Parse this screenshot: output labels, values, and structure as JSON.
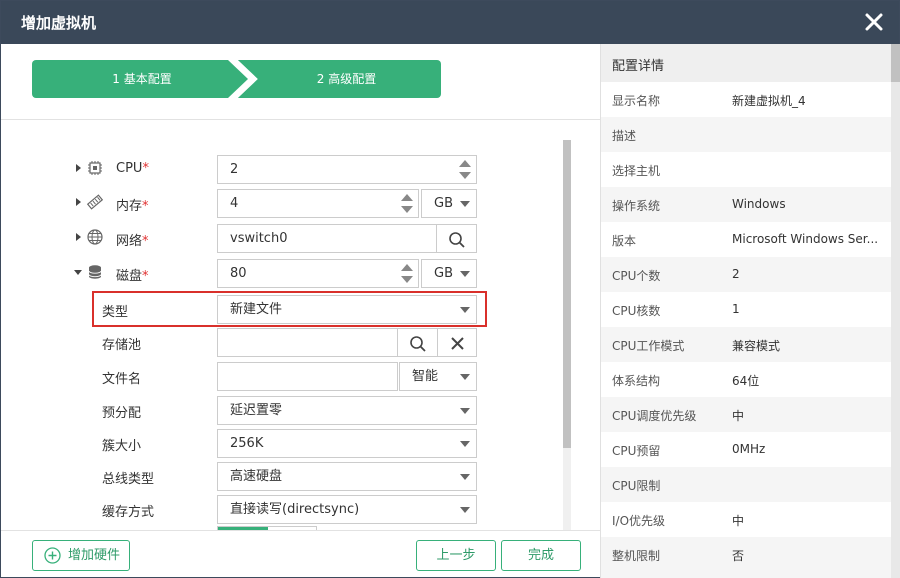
{
  "dialog": {
    "title": "增加虚拟机"
  },
  "steps": [
    {
      "label": "1 基本配置"
    },
    {
      "label": "2 高级配置"
    }
  ],
  "form": {
    "cpu": {
      "label": "CPU",
      "required_mark": "*",
      "value": "2"
    },
    "memory": {
      "label": "内存",
      "required_mark": "*",
      "value": "4",
      "unit": "GB"
    },
    "network": {
      "label": "网络",
      "required_mark": "*",
      "value": "vswitch0"
    },
    "disk": {
      "label": "磁盘",
      "required_mark": "*",
      "value": "80",
      "unit": "GB"
    },
    "type": {
      "label": "类型",
      "value": "新建文件"
    },
    "storage_pool": {
      "label": "存储池",
      "value": ""
    },
    "filename": {
      "label": "文件名",
      "value": "",
      "mode": "智能"
    },
    "prealloc": {
      "label": "预分配",
      "value": "延迟置零"
    },
    "cluster_size": {
      "label": "簇大小",
      "value": "256K"
    },
    "bus_type": {
      "label": "总线类型",
      "value": "高速硬盘"
    },
    "cache_mode": {
      "label": "缓存方式",
      "value": "直接读写(directsync)"
    }
  },
  "buttons": {
    "add_hardware": "增加硬件",
    "prev": "上一步",
    "done": "完成"
  },
  "details": {
    "title": "配置详情",
    "rows": [
      {
        "k": "显示名称",
        "v": "新建虚拟机_4"
      },
      {
        "k": "描述",
        "v": ""
      },
      {
        "k": "选择主机",
        "v": ""
      },
      {
        "k": "操作系统",
        "v": "Windows"
      },
      {
        "k": "版本",
        "v": "Microsoft Windows Ser..."
      },
      {
        "k": "CPU个数",
        "v": "2"
      },
      {
        "k": "CPU核数",
        "v": "1"
      },
      {
        "k": "CPU工作模式",
        "v": "兼容模式"
      },
      {
        "k": "体系结构",
        "v": "64位"
      },
      {
        "k": "CPU调度优先级",
        "v": "中"
      },
      {
        "k": "CPU预留",
        "v": "0MHz"
      },
      {
        "k": "CPU限制",
        "v": ""
      },
      {
        "k": "I/O优先级",
        "v": "中"
      },
      {
        "k": "整机限制",
        "v": "否"
      }
    ]
  },
  "colors": {
    "accent": "#37b07a",
    "titlebar": "#3a4859",
    "highlight": "#d9302b",
    "required": "#e03030"
  }
}
